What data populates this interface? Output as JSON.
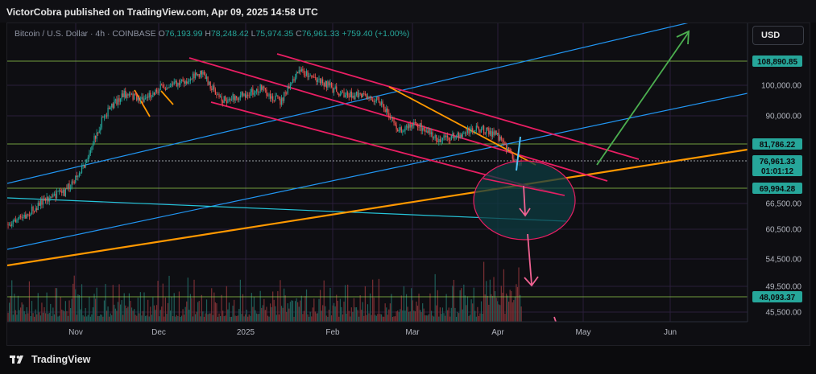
{
  "header": {
    "publisher_line": "VictorCobra published on TradingView.com, Apr 09, 2025 14:58 UTC"
  },
  "legend": {
    "symbol": "Bitcoin / U.S. Dollar · 4h · COINBASE",
    "open_label": "O",
    "open": "76,193.99",
    "high_label": "H",
    "high": "78,248.42",
    "low_label": "L",
    "low": "75,974.35",
    "close_label": "C",
    "close": "76,961.33",
    "change": "+759.40 (+1.00%)"
  },
  "currency_button": "USD",
  "footer": {
    "brand": "TradingView"
  },
  "colors": {
    "up": "#26a69a",
    "down": "#ef5350",
    "channel": "#e91e63",
    "trendline": "#ff9800",
    "blue_channel": "#2196f3",
    "arrow_up": "#4caf50",
    "highlight_fill": "#0e3b40",
    "level_line": "#8bc34a",
    "price_tag_green": "#26a69a"
  },
  "chart_data": {
    "type": "line",
    "title": "Bitcoin / U.S. Dollar · 4h · COINBASE",
    "xlabel": "",
    "ylabel": "USD",
    "x_ticks": [
      "Nov",
      "Dec",
      "2025",
      "Feb",
      "Mar",
      "Apr",
      "May",
      "Jun"
    ],
    "y_ticks": [
      "100,000.00",
      "90,000.00",
      "66,500.00",
      "60,500.00",
      "54,500.00",
      "49,500.00",
      "45,500.00"
    ],
    "ylim": [
      44000,
      118000
    ],
    "price_tags": [
      {
        "label": "108,890.85",
        "value": 108890.85,
        "kind": "level"
      },
      {
        "label": "81,786.22",
        "value": 81786.22,
        "kind": "level"
      },
      {
        "label": "76,961.33",
        "sublabel": "01:01:12",
        "value": 76961.33,
        "kind": "last_price"
      },
      {
        "label": "69,994.28",
        "value": 69994.28,
        "kind": "level"
      },
      {
        "label": "48,093.37",
        "value": 48093.37,
        "kind": "level"
      }
    ],
    "series": [
      {
        "name": "BTCUSD",
        "x": [
          "2024-10-07",
          "2024-10-14",
          "2024-10-21",
          "2024-10-28",
          "2024-11-04",
          "2024-11-11",
          "2024-11-18",
          "2024-11-25",
          "2024-12-02",
          "2024-12-09",
          "2024-12-16",
          "2024-12-23",
          "2024-12-30",
          "2025-01-06",
          "2025-01-13",
          "2025-01-20",
          "2025-01-27",
          "2025-02-03",
          "2025-02-10",
          "2025-02-17",
          "2025-02-24",
          "2025-03-03",
          "2025-03-10",
          "2025-03-17",
          "2025-03-24",
          "2025-03-31",
          "2025-04-07",
          "2025-04-09"
        ],
        "y": [
          61500,
          63500,
          67500,
          69000,
          76000,
          90000,
          97000,
          95500,
          99500,
          101000,
          104500,
          95000,
          96500,
          99000,
          94500,
          105500,
          102000,
          97500,
          96500,
          95500,
          86000,
          87500,
          83000,
          84000,
          86500,
          84500,
          76500,
          76961
        ]
      }
    ]
  }
}
